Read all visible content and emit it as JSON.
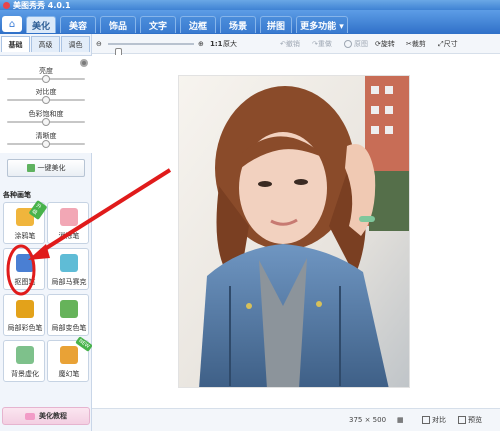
{
  "app": {
    "title": "美图秀秀 4.0.1"
  },
  "menu_tabs": [
    "美化",
    "美容",
    "饰品",
    "文字",
    "边框",
    "场景",
    "拼图",
    "更多功能 ▾"
  ],
  "left_panel": {
    "sub_tabs": [
      "基础",
      "高级",
      "调色"
    ],
    "sliders": [
      {
        "label": "亮度",
        "value": 0.5
      },
      {
        "label": "对比度",
        "value": 0.5
      },
      {
        "label": "色彩饱和度",
        "value": 0.5
      },
      {
        "label": "清晰度",
        "value": 0.5
      }
    ],
    "onekey_label": "一键美化",
    "pens_title": "各种画笔",
    "pens": [
      {
        "label": "涂鸦笔",
        "icon": "brush-icon",
        "color": "#f0b53c",
        "badge": "升级"
      },
      {
        "label": "消除笔",
        "icon": "eraser-icon",
        "color": "#f2a7b5",
        "badge": ""
      },
      {
        "label": "抠图笔",
        "icon": "cutout-pen-icon",
        "color": "#4a7fd3",
        "badge": ""
      },
      {
        "label": "局部马赛克",
        "icon": "mosaic-icon",
        "color": "#5fbcd6",
        "badge": ""
      },
      {
        "label": "局部彩色笔",
        "icon": "color-pen-icon",
        "color": "#e3a21a",
        "badge": ""
      },
      {
        "label": "局部变色笔",
        "icon": "recolor-pen-icon",
        "color": "#66b35a",
        "badge": ""
      },
      {
        "label": "背景虚化",
        "icon": "blur-icon",
        "color": "#7ec18b",
        "badge": ""
      },
      {
        "label": "魔幻笔",
        "icon": "magic-pen-icon",
        "color": "#e9a236",
        "badge": "NEW"
      }
    ],
    "tutorial_label": "美化教程"
  },
  "toolbar": {
    "zoom_value": 0.12,
    "ratio_label": "1:1",
    "original_size_label": "原大",
    "undo_label": "撤销",
    "redo_label": "重做",
    "original_label": "原图",
    "rotate_label": "旋转",
    "crop_label": "裁剪",
    "resize_label": "尺寸"
  },
  "status": {
    "size_text": "375 × 500",
    "compare_label": "对比",
    "preview_label": "预览"
  },
  "colors": {
    "accent": "#3f82d3",
    "annotation": "#e01b1b"
  }
}
